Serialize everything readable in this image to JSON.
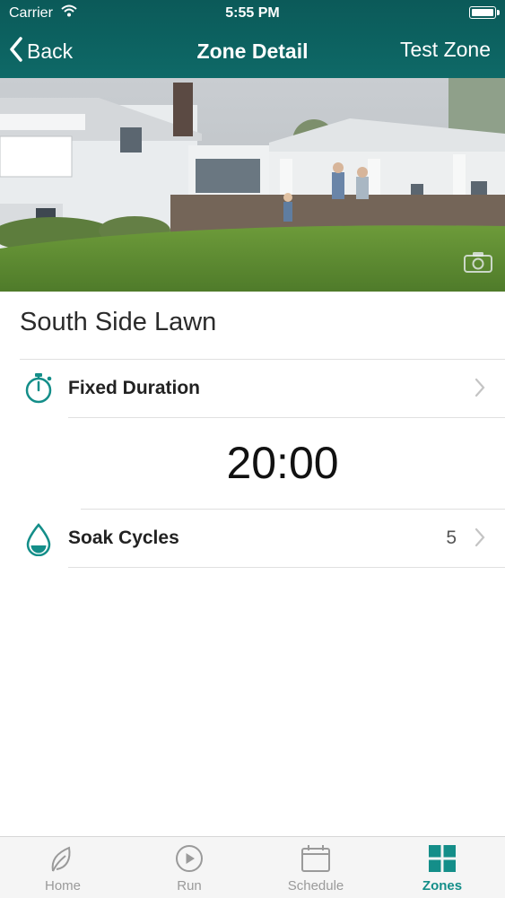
{
  "status_bar": {
    "carrier": "Carrier",
    "time": "5:55 PM"
  },
  "nav": {
    "back_label": "Back",
    "title": "Zone Detail",
    "right_action": "Test Zone"
  },
  "zone": {
    "name": "South Side Lawn",
    "rows": [
      {
        "label": "Fixed Duration",
        "icon": "stopwatch-icon"
      },
      {
        "label": "Soak Cycles",
        "value": "5",
        "icon": "water-drop-icon"
      }
    ],
    "duration": "20:00"
  },
  "tabs": [
    {
      "label": "Home",
      "icon": "leaf-icon"
    },
    {
      "label": "Run",
      "icon": "play-icon"
    },
    {
      "label": "Schedule",
      "icon": "calendar-icon"
    },
    {
      "label": "Zones",
      "icon": "grid-icon",
      "active": true
    }
  ],
  "colors": {
    "header": "#0e6967",
    "accent": "#148e89",
    "tab_inactive": "#9a9a9a"
  }
}
